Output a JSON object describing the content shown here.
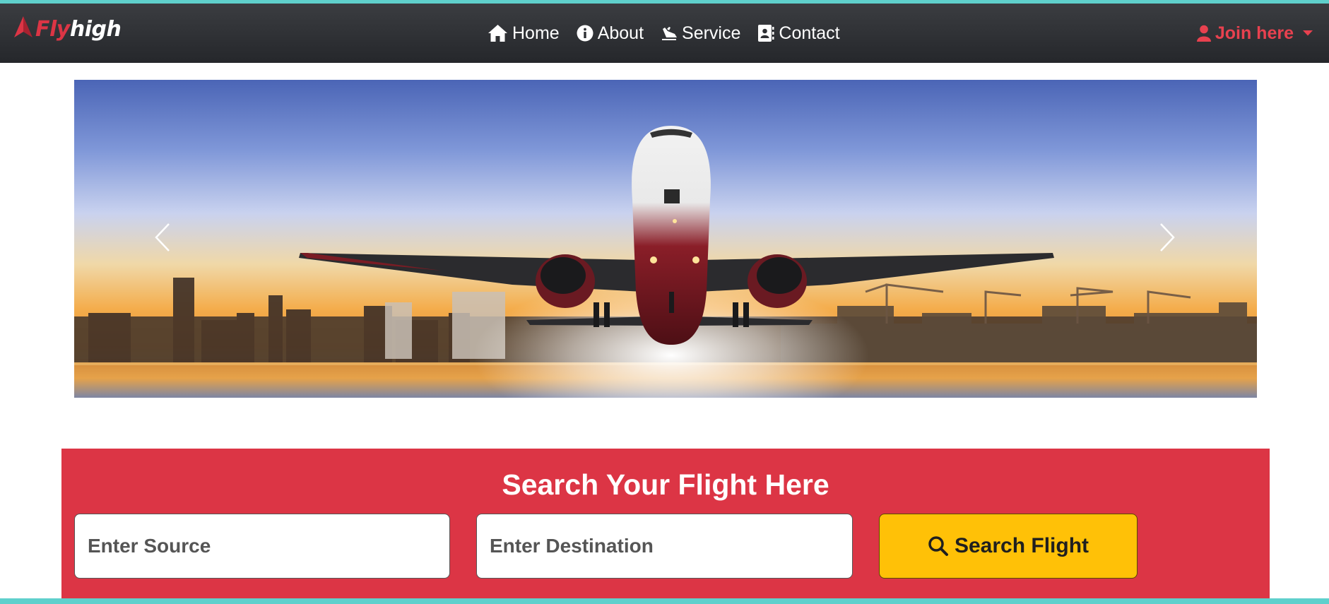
{
  "brand": {
    "fly": "Fly",
    "high": "high",
    "logo_icon": "paper-plane-icon"
  },
  "nav": {
    "items": [
      {
        "label": "Home",
        "icon": "home-icon"
      },
      {
        "label": "About",
        "icon": "info-icon"
      },
      {
        "label": "Service",
        "icon": "plane-departure-icon"
      },
      {
        "label": "Contact",
        "icon": "contact-book-icon"
      }
    ],
    "join_label": "Join here",
    "join_icon": "user-icon"
  },
  "carousel": {
    "image": "airplane-takeoff-sunset",
    "prev_icon": "chevron-left-icon",
    "next_icon": "chevron-right-icon"
  },
  "search": {
    "title": "Search Your Flight Here",
    "source_placeholder": "Enter Source",
    "destination_placeholder": "Enter Destination",
    "button_label": "Search Flight",
    "button_icon": "search-icon"
  },
  "colors": {
    "accent_red": "#dc3545",
    "button_yellow": "#ffc107",
    "navbar_dark": "#2d2f33",
    "frame_teal": "#5fd0cc"
  }
}
